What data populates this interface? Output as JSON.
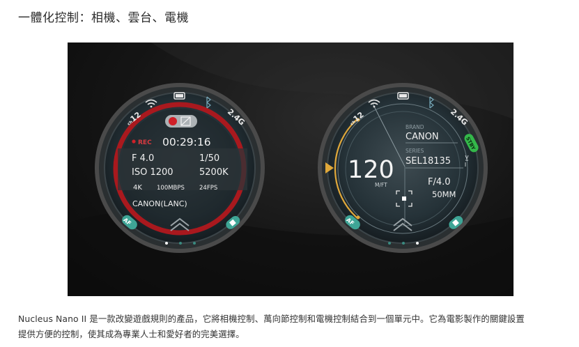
{
  "heading": "一體化控制：相機、雲台、電機",
  "left_dial": {
    "ring_top_left": "12",
    "ring_top_left_prefix": "ch",
    "ring_top_right": "2.4G",
    "rec_label": "REC",
    "timecode": "00:29:16",
    "aperture": "F 4.0",
    "shutter": "1/50",
    "iso": "ISO 1200",
    "white_balance": "5200K",
    "resolution": "4K",
    "bitrate": "100MBPS",
    "fps": "24FPS",
    "camera_link": "CANON(LANC)",
    "af_label": "AF"
  },
  "right_dial": {
    "ring_top_left": "12",
    "ring_top_left_prefix": "ch",
    "ring_top_right": "2.4G",
    "standby_badge": "STBY",
    "focus_value": "120",
    "focus_mode": "M/FT",
    "brand_label": "BRAND",
    "brand_value": "CANON",
    "series_label": "SERIES",
    "series_value": "SEL18135",
    "aperture": "F/4.0",
    "focal_length": "50MM",
    "af_label": "AF"
  },
  "description_line1": "Nucleus Nano II 是一款改變遊戲規則的產品，它將相機控制、萬向節控制和電機控制結合到一個單元中。它為電影製作的關鍵設置",
  "description_line2": "提供方便的控制，使其成為專業人士和愛好者的完美選擇。"
}
